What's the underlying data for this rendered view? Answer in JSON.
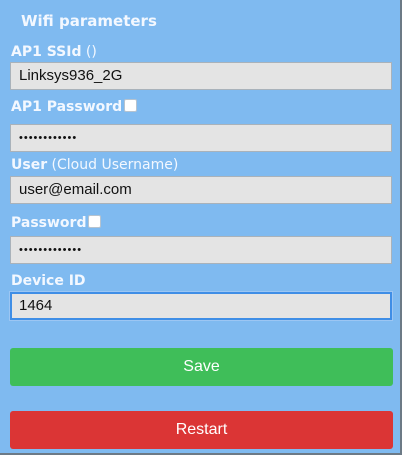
{
  "title": "Wifi parameters",
  "fields": [
    {
      "label": "AP1 SSId",
      "hint": " ()",
      "value": "Linksys936_2G",
      "type": "text",
      "has_toggle": false
    },
    {
      "label": "AP1 Password",
      "hint": "",
      "value": "••••••••••••",
      "type": "password",
      "has_toggle": true
    },
    {
      "label": "User",
      "hint": " (Cloud Username)",
      "value": "user@email.com",
      "type": "text",
      "has_toggle": false
    },
    {
      "label": "Password",
      "hint": "",
      "value": "•••••••••••••",
      "type": "password",
      "has_toggle": true
    },
    {
      "label": "Device ID",
      "hint": "",
      "value": "1464",
      "type": "text",
      "has_toggle": false
    }
  ],
  "buttons": {
    "save": "Save",
    "restart": "Restart"
  },
  "colors": {
    "panel_bg": "#7fbaf0",
    "save": "#3fbe59",
    "restart": "#db3535",
    "focus": "#3f8ee6"
  }
}
